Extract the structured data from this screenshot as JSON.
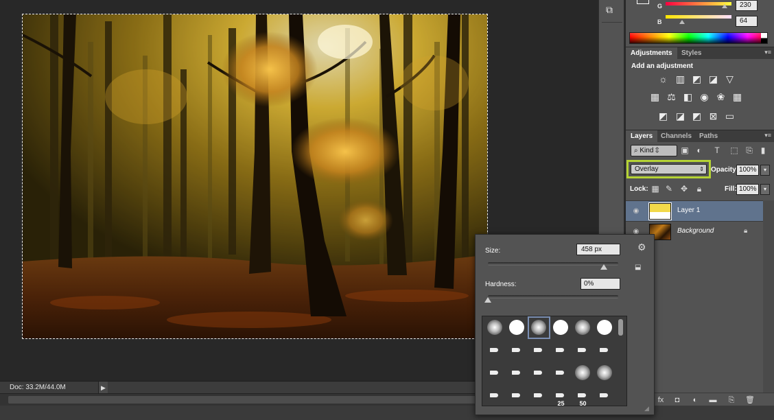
{
  "status": {
    "doc_info": "Doc: 33.2M/44.0M"
  },
  "color_panel": {
    "channels": [
      {
        "label": "G",
        "value": "230",
        "thumb_pct": 90
      },
      {
        "label": "B",
        "value": "64",
        "thumb_pct": 25
      }
    ]
  },
  "adjustments": {
    "tabs": [
      "Adjustments",
      "Styles"
    ],
    "heading": "Add an adjustment",
    "icons": [
      "brightness-contrast-icon",
      "levels-icon",
      "curves-icon",
      "exposure-icon",
      "vibrance-icon",
      "hue-saturation-icon",
      "color-balance-icon",
      "black-white-icon",
      "photo-filter-icon",
      "channel-mixer-icon",
      "color-lookup-icon",
      "invert-icon",
      "posterize-icon",
      "threshold-icon",
      "selective-color-icon",
      "gradient-map-icon"
    ]
  },
  "layers": {
    "tabs": [
      "Layers",
      "Channels",
      "Paths"
    ],
    "filter_kind": "Kind",
    "blend_mode": "Overlay",
    "opacity_label": "Opacity:",
    "opacity": "100%",
    "lock_label": "Lock:",
    "fill_label": "Fill:",
    "fill": "100%",
    "items": [
      {
        "name": "Layer 1",
        "selected": true
      },
      {
        "name": "Background",
        "selected": false,
        "locked": true
      }
    ]
  },
  "brush": {
    "size_label": "Size:",
    "size_value": "458 px",
    "size_pct": 89,
    "hardness_label": "Hardness:",
    "hardness_value": "0%",
    "hardness_pct": 0,
    "preset_numbers": [
      "25",
      "50"
    ]
  },
  "colors": {
    "accent_highlight": "#b5d334",
    "selected_layer": "#60738d"
  }
}
